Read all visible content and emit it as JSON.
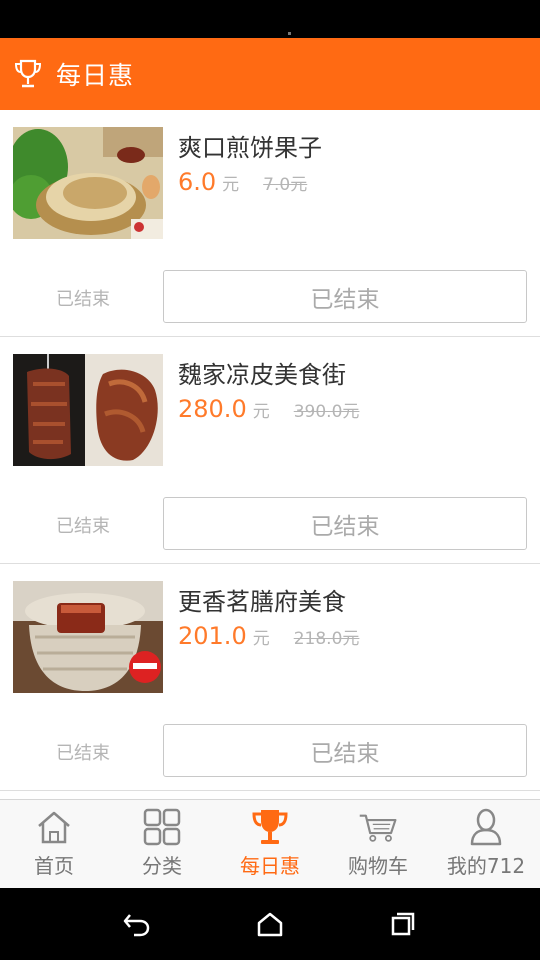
{
  "header": {
    "title": "每日惠"
  },
  "items": [
    {
      "name": "爽口煎饼果子",
      "price": "6.0",
      "unit": "元",
      "original_price": "7.0元",
      "status_label": "已结束",
      "button_label": "已结束"
    },
    {
      "name": "魏家凉皮美食街",
      "price": "280.0",
      "unit": "元",
      "original_price": "390.0元",
      "status_label": "已结束",
      "button_label": "已结束"
    },
    {
      "name": "更香茗膳府美食",
      "price": "201.0",
      "unit": "元",
      "original_price": "218.0元",
      "status_label": "已结束",
      "button_label": "已结束"
    }
  ],
  "tabbar": [
    {
      "label": "首页",
      "icon": "home-icon"
    },
    {
      "label": "分类",
      "icon": "grid-icon"
    },
    {
      "label": "每日惠",
      "icon": "trophy-icon",
      "active": true
    },
    {
      "label": "购物车",
      "icon": "cart-icon"
    },
    {
      "label": "我的712",
      "icon": "user-icon"
    }
  ],
  "navbar": {
    "icons": [
      "back-icon",
      "home-icon",
      "recents-icon"
    ]
  },
  "colors": {
    "accent": "#ff6a13",
    "price": "#ff7a2a",
    "muted": "#b5b5b5"
  }
}
